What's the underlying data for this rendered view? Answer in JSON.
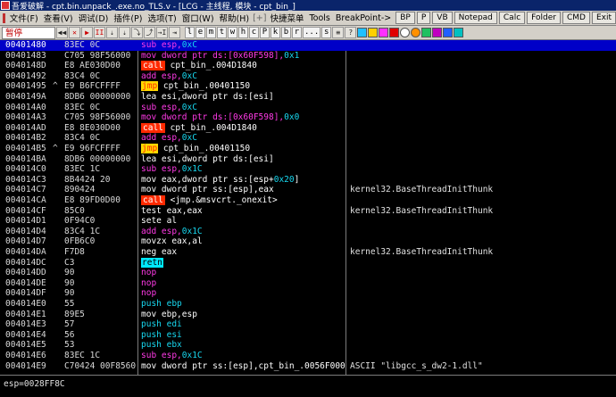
{
  "window": {
    "title": "吾爱破解 - cpt.bin.unpack_.exe.no_TLS.v - [LCG - 主线程, 模块 - cpt_bin_]"
  },
  "menu": {
    "items": [
      "文件(F)",
      "查看(V)",
      "调试(D)",
      "插件(P)",
      "选项(T)",
      "窗口(W)",
      "帮助(H)",
      "[+]",
      "快捷菜单",
      "Tools",
      "BreakPoint->"
    ],
    "right_buttons": [
      "BP",
      "P",
      "VB",
      "Notepad",
      "Calc",
      "Folder",
      "CMD",
      "Exit"
    ]
  },
  "toolbar": {
    "status": "暂停",
    "buttons": [
      "◀◀",
      "✕",
      "▶",
      "II",
      "⇣",
      "⇣",
      "⤵",
      "⤴",
      "→I",
      "⇥"
    ],
    "letter_buttons": [
      "l",
      "e",
      "m",
      "t",
      "w",
      "h",
      "c",
      "P",
      "k",
      "b",
      "r",
      "...",
      "s"
    ]
  },
  "rows": [
    {
      "addr": "00401480",
      "jmp": "",
      "hex": "83EC 0C",
      "dis": [
        [
          "m",
          "sub esp,"
        ],
        [
          "c",
          "0xC"
        ]
      ],
      "cmt": ""
    },
    {
      "addr": "00401483",
      "jmp": "",
      "hex": "C705 98F56000",
      "dis": [
        [
          "m",
          "mov dword ptr ds:[0x60F598],"
        ],
        [
          "c",
          "0x1"
        ]
      ],
      "cmt": ""
    },
    {
      "addr": "0040148D",
      "jmp": "",
      "hex": "E8 AE030D00",
      "dis": [
        [
          "call",
          "call"
        ],
        [
          "w",
          " cpt_bin_.004D1840"
        ]
      ],
      "cmt": ""
    },
    {
      "addr": "00401492",
      "jmp": "",
      "hex": "83C4 0C",
      "dis": [
        [
          "m",
          "add esp,"
        ],
        [
          "c",
          "0xC"
        ]
      ],
      "cmt": ""
    },
    {
      "addr": "00401495",
      "jmp": "^",
      "hex": "E9 B6FCFFFF",
      "dis": [
        [
          "jmp",
          "jmp"
        ],
        [
          "w",
          " cpt_bin_.00401150"
        ]
      ],
      "cmt": ""
    },
    {
      "addr": "0040149A",
      "jmp": "",
      "hex": "8DB6 00000000",
      "dis": [
        [
          "w",
          "lea esi,dword ptr ds:[esi]"
        ]
      ],
      "cmt": ""
    },
    {
      "addr": "004014A0",
      "jmp": "",
      "hex": "83EC 0C",
      "dis": [
        [
          "m",
          "sub esp,"
        ],
        [
          "c",
          "0xC"
        ]
      ],
      "cmt": ""
    },
    {
      "addr": "004014A3",
      "jmp": "",
      "hex": "C705 98F56000",
      "dis": [
        [
          "m",
          "mov dword ptr ds:[0x60F598],"
        ],
        [
          "c",
          "0x0"
        ]
      ],
      "cmt": ""
    },
    {
      "addr": "004014AD",
      "jmp": "",
      "hex": "E8 8E030D00",
      "dis": [
        [
          "call",
          "call"
        ],
        [
          "w",
          " cpt_bin_.004D1840"
        ]
      ],
      "cmt": ""
    },
    {
      "addr": "004014B2",
      "jmp": "",
      "hex": "83C4 0C",
      "dis": [
        [
          "m",
          "add esp,"
        ],
        [
          "c",
          "0xC"
        ]
      ],
      "cmt": ""
    },
    {
      "addr": "004014B5",
      "jmp": "^",
      "hex": "E9 96FCFFFF",
      "dis": [
        [
          "jmp",
          "jmp"
        ],
        [
          "w",
          " cpt_bin_.00401150"
        ]
      ],
      "cmt": ""
    },
    {
      "addr": "004014BA",
      "jmp": "",
      "hex": "8DB6 00000000",
      "dis": [
        [
          "w",
          "lea esi,dword ptr ds:[esi]"
        ]
      ],
      "cmt": ""
    },
    {
      "addr": "004014C0",
      "jmp": "",
      "hex": "83EC 1C",
      "dis": [
        [
          "m",
          "sub esp,"
        ],
        [
          "c",
          "0x1C"
        ]
      ],
      "cmt": ""
    },
    {
      "addr": "004014C3",
      "jmp": "",
      "hex": "8B4424 20",
      "dis": [
        [
          "w",
          "mov eax,dword ptr ss:[esp+"
        ],
        [
          "c",
          "0x20"
        ],
        [
          "w",
          "]"
        ]
      ],
      "cmt": ""
    },
    {
      "addr": "004014C7",
      "jmp": "",
      "hex": "890424",
      "dis": [
        [
          "w",
          "mov dword ptr ss:[esp],eax"
        ]
      ],
      "cmt": "kernel32.BaseThreadInitThunk"
    },
    {
      "addr": "004014CA",
      "jmp": "",
      "hex": "E8 89FD0D00",
      "dis": [
        [
          "call",
          "call"
        ],
        [
          "w",
          " <jmp.&msvcrt._onexit>"
        ]
      ],
      "cmt": ""
    },
    {
      "addr": "004014CF",
      "jmp": "",
      "hex": "85C0",
      "dis": [
        [
          "w",
          "test eax,eax"
        ]
      ],
      "cmt": "kernel32.BaseThreadInitThunk"
    },
    {
      "addr": "004014D1",
      "jmp": "",
      "hex": "0F94C0",
      "dis": [
        [
          "w",
          "sete al"
        ]
      ],
      "cmt": ""
    },
    {
      "addr": "004014D4",
      "jmp": "",
      "hex": "83C4 1C",
      "dis": [
        [
          "m",
          "add esp,"
        ],
        [
          "c",
          "0x1C"
        ]
      ],
      "cmt": ""
    },
    {
      "addr": "004014D7",
      "jmp": "",
      "hex": "0FB6C0",
      "dis": [
        [
          "w",
          "movzx eax,al"
        ]
      ],
      "cmt": ""
    },
    {
      "addr": "004014DA",
      "jmp": "",
      "hex": "F7D8",
      "dis": [
        [
          "w",
          "neg eax"
        ]
      ],
      "cmt": "kernel32.BaseThreadInitThunk"
    },
    {
      "addr": "004014DC",
      "jmp": "",
      "hex": "C3",
      "dis": [
        [
          "retn",
          "retn"
        ]
      ],
      "cmt": ""
    },
    {
      "addr": "004014DD",
      "jmp": "",
      "hex": "90",
      "dis": [
        [
          "m",
          "nop"
        ]
      ],
      "cmt": ""
    },
    {
      "addr": "004014DE",
      "jmp": "",
      "hex": "90",
      "dis": [
        [
          "m",
          "nop"
        ]
      ],
      "cmt": ""
    },
    {
      "addr": "004014DF",
      "jmp": "",
      "hex": "90",
      "dis": [
        [
          "m",
          "nop"
        ]
      ],
      "cmt": ""
    },
    {
      "addr": "004014E0",
      "jmp": "",
      "hex": "55",
      "dis": [
        [
          "push",
          "push ebp"
        ]
      ],
      "cmt": ""
    },
    {
      "addr": "004014E1",
      "jmp": "",
      "hex": "89E5",
      "dis": [
        [
          "w",
          "mov ebp,esp"
        ]
      ],
      "cmt": ""
    },
    {
      "addr": "004014E3",
      "jmp": "",
      "hex": "57",
      "dis": [
        [
          "push",
          "push edi"
        ]
      ],
      "cmt": ""
    },
    {
      "addr": "004014E4",
      "jmp": "",
      "hex": "56",
      "dis": [
        [
          "push",
          "push esi"
        ]
      ],
      "cmt": ""
    },
    {
      "addr": "004014E5",
      "jmp": "",
      "hex": "53",
      "dis": [
        [
          "push",
          "push ebx"
        ]
      ],
      "cmt": ""
    },
    {
      "addr": "004014E6",
      "jmp": "",
      "hex": "83EC 1C",
      "dis": [
        [
          "m",
          "sub esp,"
        ],
        [
          "c",
          "0x1C"
        ]
      ],
      "cmt": ""
    },
    {
      "addr": "004014E9",
      "jmp": "",
      "hex": "C70424 00F8560",
      "dis": [
        [
          "w",
          "mov dword ptr ss:[esp],cpt_bin_.0056F000"
        ]
      ],
      "cmt": "ASCII \"libgcc_s_dw2-1.dll\""
    }
  ],
  "bottom_status": "esp=0028FF8C"
}
